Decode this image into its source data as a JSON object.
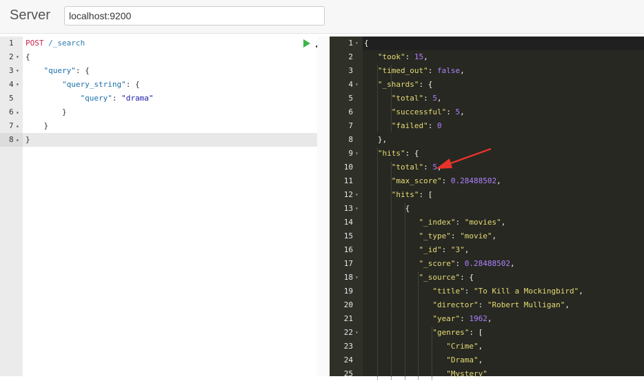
{
  "header": {
    "server_label": "Server",
    "server_url": "localhost:9200"
  },
  "request_editor": {
    "lines": [
      {
        "num": "1",
        "fold": "",
        "tokens": [
          {
            "t": "POST",
            "c": "tok-method"
          },
          {
            "t": " /_search",
            "c": "tok-url"
          }
        ]
      },
      {
        "num": "2",
        "fold": "▾",
        "tokens": [
          {
            "t": "{",
            "c": "tok-punct-l"
          }
        ]
      },
      {
        "num": "3",
        "fold": "▾",
        "tokens": [
          {
            "t": "    ",
            "c": "tok-punct-l"
          },
          {
            "t": "\"query\"",
            "c": "tok-key-l"
          },
          {
            "t": ": {",
            "c": "tok-punct-l"
          }
        ]
      },
      {
        "num": "4",
        "fold": "▾",
        "tokens": [
          {
            "t": "        ",
            "c": "tok-punct-l"
          },
          {
            "t": "\"query_string\"",
            "c": "tok-key-l"
          },
          {
            "t": ": {",
            "c": "tok-punct-l"
          }
        ]
      },
      {
        "num": "5",
        "fold": "",
        "tokens": [
          {
            "t": "            ",
            "c": "tok-punct-l"
          },
          {
            "t": "\"query\"",
            "c": "tok-key-l"
          },
          {
            "t": ": ",
            "c": "tok-punct-l"
          },
          {
            "t": "\"drama\"",
            "c": "tok-str-l"
          }
        ]
      },
      {
        "num": "6",
        "fold": "▴",
        "tokens": [
          {
            "t": "        }",
            "c": "tok-punct-l"
          }
        ]
      },
      {
        "num": "7",
        "fold": "▴",
        "tokens": [
          {
            "t": "    }",
            "c": "tok-punct-l"
          }
        ]
      },
      {
        "num": "8",
        "fold": "▴",
        "tokens": [
          {
            "t": "}",
            "c": "tok-punct-l"
          }
        ]
      }
    ]
  },
  "response_viewer": {
    "lines": [
      {
        "num": "1",
        "fold": "▾",
        "tokens": [
          {
            "t": "{",
            "c": "tok-p"
          }
        ]
      },
      {
        "num": "2",
        "fold": "",
        "tokens": [
          {
            "t": "   ",
            "c": "tok-p"
          },
          {
            "t": "\"took\"",
            "c": "tok-key"
          },
          {
            "t": ": ",
            "c": "tok-p"
          },
          {
            "t": "15",
            "c": "tok-num"
          },
          {
            "t": ",",
            "c": "tok-p"
          }
        ]
      },
      {
        "num": "3",
        "fold": "",
        "tokens": [
          {
            "t": "   ",
            "c": "tok-p"
          },
          {
            "t": "\"timed_out\"",
            "c": "tok-key"
          },
          {
            "t": ": ",
            "c": "tok-p"
          },
          {
            "t": "false",
            "c": "tok-bool"
          },
          {
            "t": ",",
            "c": "tok-p"
          }
        ]
      },
      {
        "num": "4",
        "fold": "▾",
        "tokens": [
          {
            "t": "   ",
            "c": "tok-p"
          },
          {
            "t": "\"_shards\"",
            "c": "tok-key"
          },
          {
            "t": ": {",
            "c": "tok-p"
          }
        ]
      },
      {
        "num": "5",
        "fold": "",
        "tokens": [
          {
            "t": "      ",
            "c": "tok-p"
          },
          {
            "t": "\"total\"",
            "c": "tok-key"
          },
          {
            "t": ": ",
            "c": "tok-p"
          },
          {
            "t": "5",
            "c": "tok-num"
          },
          {
            "t": ",",
            "c": "tok-p"
          }
        ]
      },
      {
        "num": "6",
        "fold": "",
        "tokens": [
          {
            "t": "      ",
            "c": "tok-p"
          },
          {
            "t": "\"successful\"",
            "c": "tok-key"
          },
          {
            "t": ": ",
            "c": "tok-p"
          },
          {
            "t": "5",
            "c": "tok-num"
          },
          {
            "t": ",",
            "c": "tok-p"
          }
        ]
      },
      {
        "num": "7",
        "fold": "",
        "tokens": [
          {
            "t": "      ",
            "c": "tok-p"
          },
          {
            "t": "\"failed\"",
            "c": "tok-key"
          },
          {
            "t": ": ",
            "c": "tok-p"
          },
          {
            "t": "0",
            "c": "tok-num"
          }
        ]
      },
      {
        "num": "8",
        "fold": "",
        "tokens": [
          {
            "t": "   },",
            "c": "tok-p"
          }
        ]
      },
      {
        "num": "9",
        "fold": "▾",
        "tokens": [
          {
            "t": "   ",
            "c": "tok-p"
          },
          {
            "t": "\"hits\"",
            "c": "tok-key"
          },
          {
            "t": ": {",
            "c": "tok-p"
          }
        ]
      },
      {
        "num": "10",
        "fold": "",
        "tokens": [
          {
            "t": "      ",
            "c": "tok-p"
          },
          {
            "t": "\"total\"",
            "c": "tok-key"
          },
          {
            "t": ": ",
            "c": "tok-p"
          },
          {
            "t": "5",
            "c": "tok-num"
          },
          {
            "t": ",",
            "c": "tok-p"
          }
        ]
      },
      {
        "num": "11",
        "fold": "",
        "tokens": [
          {
            "t": "      ",
            "c": "tok-p"
          },
          {
            "t": "\"max_score\"",
            "c": "tok-key"
          },
          {
            "t": ": ",
            "c": "tok-p"
          },
          {
            "t": "0.28488502",
            "c": "tok-num"
          },
          {
            "t": ",",
            "c": "tok-p"
          }
        ]
      },
      {
        "num": "12",
        "fold": "▾",
        "tokens": [
          {
            "t": "      ",
            "c": "tok-p"
          },
          {
            "t": "\"hits\"",
            "c": "tok-key"
          },
          {
            "t": ": [",
            "c": "tok-p"
          }
        ]
      },
      {
        "num": "13",
        "fold": "▾",
        "tokens": [
          {
            "t": "         {",
            "c": "tok-p"
          }
        ]
      },
      {
        "num": "14",
        "fold": "",
        "tokens": [
          {
            "t": "            ",
            "c": "tok-p"
          },
          {
            "t": "\"_index\"",
            "c": "tok-key"
          },
          {
            "t": ": ",
            "c": "tok-p"
          },
          {
            "t": "\"movies\"",
            "c": "tok-str"
          },
          {
            "t": ",",
            "c": "tok-p"
          }
        ]
      },
      {
        "num": "15",
        "fold": "",
        "tokens": [
          {
            "t": "            ",
            "c": "tok-p"
          },
          {
            "t": "\"_type\"",
            "c": "tok-key"
          },
          {
            "t": ": ",
            "c": "tok-p"
          },
          {
            "t": "\"movie\"",
            "c": "tok-str"
          },
          {
            "t": ",",
            "c": "tok-p"
          }
        ]
      },
      {
        "num": "16",
        "fold": "",
        "tokens": [
          {
            "t": "            ",
            "c": "tok-p"
          },
          {
            "t": "\"_id\"",
            "c": "tok-key"
          },
          {
            "t": ": ",
            "c": "tok-p"
          },
          {
            "t": "\"3\"",
            "c": "tok-str"
          },
          {
            "t": ",",
            "c": "tok-p"
          }
        ]
      },
      {
        "num": "17",
        "fold": "",
        "tokens": [
          {
            "t": "            ",
            "c": "tok-p"
          },
          {
            "t": "\"_score\"",
            "c": "tok-key"
          },
          {
            "t": ": ",
            "c": "tok-p"
          },
          {
            "t": "0.28488502",
            "c": "tok-num"
          },
          {
            "t": ",",
            "c": "tok-p"
          }
        ]
      },
      {
        "num": "18",
        "fold": "▾",
        "tokens": [
          {
            "t": "            ",
            "c": "tok-p"
          },
          {
            "t": "\"_source\"",
            "c": "tok-key"
          },
          {
            "t": ": {",
            "c": "tok-p"
          }
        ]
      },
      {
        "num": "19",
        "fold": "",
        "tokens": [
          {
            "t": "               ",
            "c": "tok-p"
          },
          {
            "t": "\"title\"",
            "c": "tok-key"
          },
          {
            "t": ": ",
            "c": "tok-p"
          },
          {
            "t": "\"To Kill a Mockingbird\"",
            "c": "tok-str"
          },
          {
            "t": ",",
            "c": "tok-p"
          }
        ]
      },
      {
        "num": "20",
        "fold": "",
        "tokens": [
          {
            "t": "               ",
            "c": "tok-p"
          },
          {
            "t": "\"director\"",
            "c": "tok-key"
          },
          {
            "t": ": ",
            "c": "tok-p"
          },
          {
            "t": "\"Robert Mulligan\"",
            "c": "tok-str"
          },
          {
            "t": ",",
            "c": "tok-p"
          }
        ]
      },
      {
        "num": "21",
        "fold": "",
        "tokens": [
          {
            "t": "               ",
            "c": "tok-p"
          },
          {
            "t": "\"year\"",
            "c": "tok-key"
          },
          {
            "t": ": ",
            "c": "tok-p"
          },
          {
            "t": "1962",
            "c": "tok-num"
          },
          {
            "t": ",",
            "c": "tok-p"
          }
        ]
      },
      {
        "num": "22",
        "fold": "▾",
        "tokens": [
          {
            "t": "               ",
            "c": "tok-p"
          },
          {
            "t": "\"genres\"",
            "c": "tok-key"
          },
          {
            "t": ": [",
            "c": "tok-p"
          }
        ]
      },
      {
        "num": "23",
        "fold": "",
        "tokens": [
          {
            "t": "                  ",
            "c": "tok-p"
          },
          {
            "t": "\"Crime\"",
            "c": "tok-str"
          },
          {
            "t": ",",
            "c": "tok-p"
          }
        ]
      },
      {
        "num": "24",
        "fold": "",
        "tokens": [
          {
            "t": "                  ",
            "c": "tok-p"
          },
          {
            "t": "\"Drama\"",
            "c": "tok-str"
          },
          {
            "t": ",",
            "c": "tok-p"
          }
        ]
      },
      {
        "num": "25",
        "fold": "",
        "tokens": [
          {
            "t": "                  ",
            "c": "tok-p"
          },
          {
            "t": "\"Mystery\"",
            "c": "tok-str"
          }
        ]
      }
    ]
  },
  "icons": {
    "run": "play-icon",
    "settings": "wrench-icon",
    "annotation": "arrow-annotation-icon"
  },
  "colors": {
    "run_icon": "#3cb44b",
    "annotation_arrow": "#e8332b",
    "response_bg": "#272822"
  }
}
